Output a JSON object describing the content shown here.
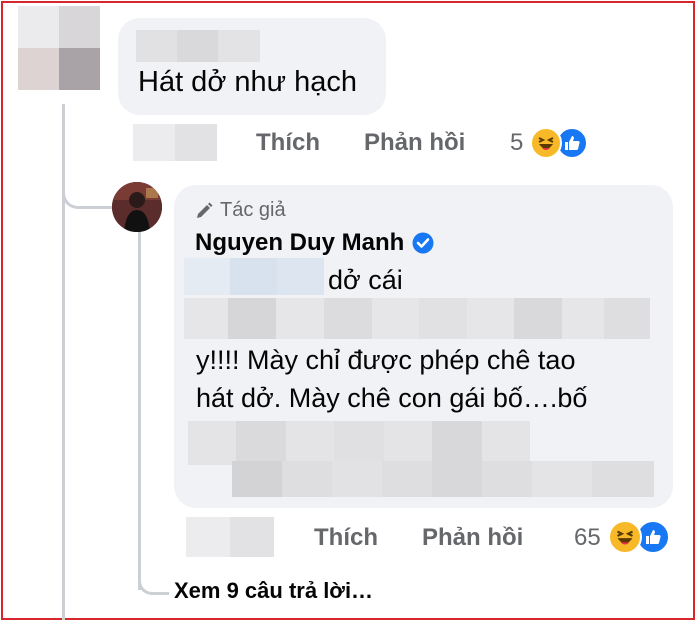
{
  "comment": {
    "text": "Hát dở như hạch",
    "like_label": "Thích",
    "reply_label": "Phản hồi",
    "reaction_count": "5"
  },
  "reply": {
    "badge": "Tác giả",
    "author": "Nguyen Duy Manh",
    "line1": "dở cái",
    "line2": "y!!!! Mày chỉ được phép chê tao",
    "line3": "hát dở. Mày chê con gái bố….bố",
    "like_label": "Thích",
    "reply_label": "Phản hồi",
    "reaction_count": "65"
  },
  "view_replies": "Xem 9 câu trả lời…",
  "colors": {
    "frame": "#d9262c",
    "bubble": "#f0f2f5",
    "muted": "#65676b",
    "verified": "#1877f2",
    "haha": "#f7b928",
    "like": "#1877f2"
  }
}
